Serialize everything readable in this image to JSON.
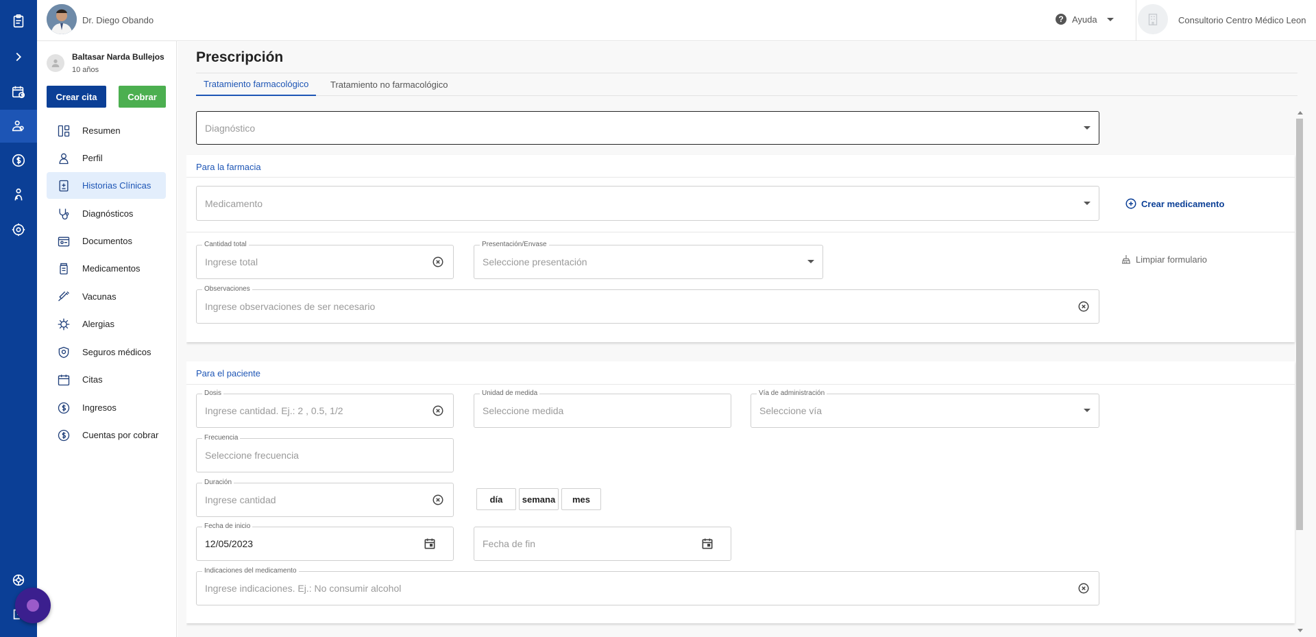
{
  "header": {
    "doctor_name": "Dr. Diego Obando",
    "help_label": "Ayuda",
    "clinic_name": "Consultorio Centro Médico Leon"
  },
  "patient": {
    "name": "Baltasar Narda Bullejos",
    "age": "10 años"
  },
  "actions": {
    "create_appointment": "Crear cita",
    "charge": "Cobrar"
  },
  "nav": {
    "items": [
      {
        "label": "Resumen",
        "icon": "summary-icon"
      },
      {
        "label": "Perfil",
        "icon": "profile-icon"
      },
      {
        "label": "Historias Clínicas",
        "icon": "clinical-history-icon",
        "active": true
      },
      {
        "label": "Diagnósticos",
        "icon": "stethoscope-icon"
      },
      {
        "label": "Documentos",
        "icon": "documents-icon"
      },
      {
        "label": "Medicamentos",
        "icon": "medicine-bottle-icon"
      },
      {
        "label": "Vacunas",
        "icon": "syringe-icon"
      },
      {
        "label": "Alergias",
        "icon": "allergy-icon"
      },
      {
        "label": "Seguros médicos",
        "icon": "shield-icon"
      },
      {
        "label": "Citas",
        "icon": "calendar-icon"
      },
      {
        "label": "Ingresos",
        "icon": "dollar-icon"
      },
      {
        "label": "Cuentas por cobrar",
        "icon": "receivables-icon"
      }
    ]
  },
  "main": {
    "title": "Prescripción",
    "tabs": [
      {
        "label": "Tratamiento farmacológico",
        "active": true
      },
      {
        "label": "Tratamiento no farmacológico",
        "active": false
      }
    ],
    "diagnosis_placeholder": "Diagnóstico",
    "pharmacy": {
      "title": "Para la farmacia",
      "medication_placeholder": "Medicamento",
      "create_medication": "Crear medicamento",
      "clear_form": "Limpiar formulario",
      "total_quantity": {
        "label": "Cantidad total",
        "placeholder": "Ingrese total"
      },
      "presentation": {
        "label": "Presentación/Envase",
        "placeholder": "Seleccione presentación"
      },
      "observations": {
        "label": "Observaciones",
        "placeholder": "Ingrese observaciones de ser necesario"
      }
    },
    "patient_section": {
      "title": "Para el paciente",
      "dose": {
        "label": "Dosis",
        "placeholder": "Ingrese cantidad. Ej.: 2 , 0.5, 1/2"
      },
      "unit": {
        "label": "Unidad de medida",
        "placeholder": "Seleccione medida"
      },
      "route": {
        "label": "Vía de administración",
        "placeholder": "Seleccione vía"
      },
      "frequency": {
        "label": "Frecuencia",
        "placeholder": "Seleccione frecuencia"
      },
      "duration": {
        "label": "Duración",
        "placeholder": "Ingrese cantidad"
      },
      "duration_units": [
        "día",
        "semana",
        "mes"
      ],
      "start_date": {
        "label": "Fecha de inicio",
        "value": "12/05/2023"
      },
      "end_date": {
        "placeholder": "Fecha de fin"
      },
      "instructions": {
        "label": "Indicaciones del medicamento",
        "placeholder": "Ingrese indicaciones. Ej.: No consumir alcohol"
      }
    }
  },
  "colors": {
    "rail": "#0b3f96",
    "accent": "#1d55b5",
    "charge_green": "#4caf50"
  }
}
